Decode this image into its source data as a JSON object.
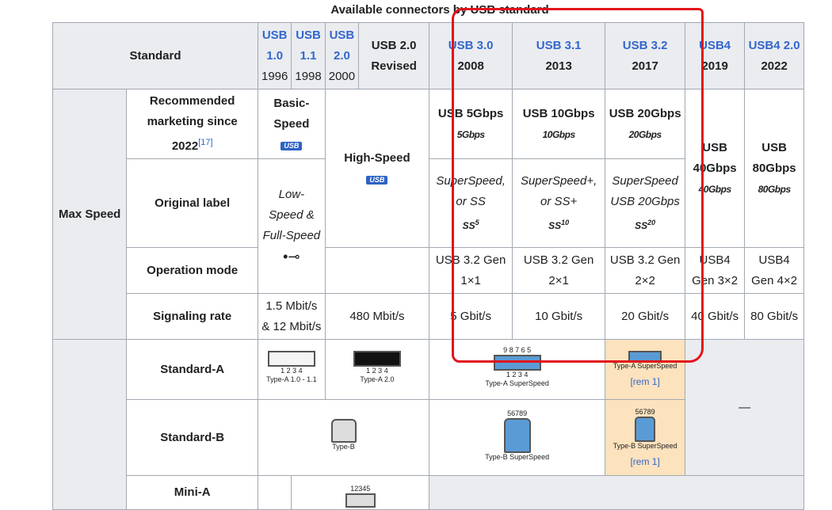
{
  "caption": "Available connectors by USB standard",
  "header": {
    "standard": "Standard",
    "usb10": {
      "name": "USB 1.0",
      "year": "1996"
    },
    "usb11": {
      "name": "USB 1.1",
      "year": "1998"
    },
    "usb20": {
      "name": "USB 2.0",
      "year": "2000"
    },
    "usb20r": {
      "name": "USB 2.0 Revised"
    },
    "usb30": {
      "name": "USB 3.0",
      "year": "2008"
    },
    "usb31": {
      "name": "USB 3.1",
      "year": "2013"
    },
    "usb32": {
      "name": "USB 3.2",
      "year": "2017"
    },
    "usb4": {
      "name": "USB4",
      "year": "2019"
    },
    "usb42": {
      "name": "USB4 2.0",
      "year": "2022"
    }
  },
  "maxspeed": {
    "label": "Max Speed",
    "marketing_label": "Recommended marketing since 2022",
    "marketing_ref": "[17]",
    "original_label": "Original label",
    "operation_mode": "Operation mode",
    "signaling_rate": "Signaling rate",
    "basic_speed": "Basic-Speed",
    "high_speed": "High-Speed",
    "usb5": "USB 5Gbps",
    "usb10": "USB 10Gbps",
    "usb20": "USB 20Gbps",
    "usb40": "USB 40Gbps",
    "usb80": "USB 80Gbps",
    "logo5": "5Gbps",
    "logo10": "10Gbps",
    "logo20": "20Gbps",
    "logo40": "40Gbps",
    "logo80": "80Gbps",
    "usb_badge": "USB",
    "orig_low": "Low-Speed & Full-Speed",
    "orig_ss": "SuperSpeed, or SS",
    "orig_ssp": "SuperSpeed+, or SS+",
    "orig_ss20": "SuperSpeed USB 20Gbps",
    "ss_logo": "SS",
    "ss5": "5",
    "ss10": "10",
    "ss20": "20",
    "mode31": "USB 3.2 Gen 1×1",
    "mode32": "USB 3.2 Gen 2×1",
    "mode33": "USB 3.2 Gen 2×2",
    "mode4a": "USB4 Gen 3×2",
    "mode4b": "USB4 Gen 4×2",
    "rate_low": "1.5 Mbit/s & 12 Mbit/s",
    "rate_high": "480 Mbit/s",
    "rate5": "5 Gbit/s",
    "rate10": "10 Gbit/s",
    "rate20": "20 Gbit/s",
    "rate40": "40 Gbit/s",
    "rate80": "80 Gbit/s"
  },
  "connectors": {
    "standard_a": "Standard-A",
    "standard_b": "Standard-B",
    "mini_a": "Mini-A",
    "typeA10": "Type-A 1.0 - 1.1",
    "typeA20": "Type-A 2.0",
    "typeASS": "Type-A SuperSpeed",
    "typeB": "Type-B",
    "typeBSS": "Type-B SuperSpeed",
    "pins_a": "1 2 3 4",
    "pins_ass": "9 8 7 6 5",
    "pins_b": "56789",
    "pins_mini": "12345",
    "rem1": "[rem 1]",
    "dash": "—"
  },
  "colors": {
    "highlight": "#fce2bd",
    "annotation": "#e1141a",
    "link": "#3366cc"
  }
}
